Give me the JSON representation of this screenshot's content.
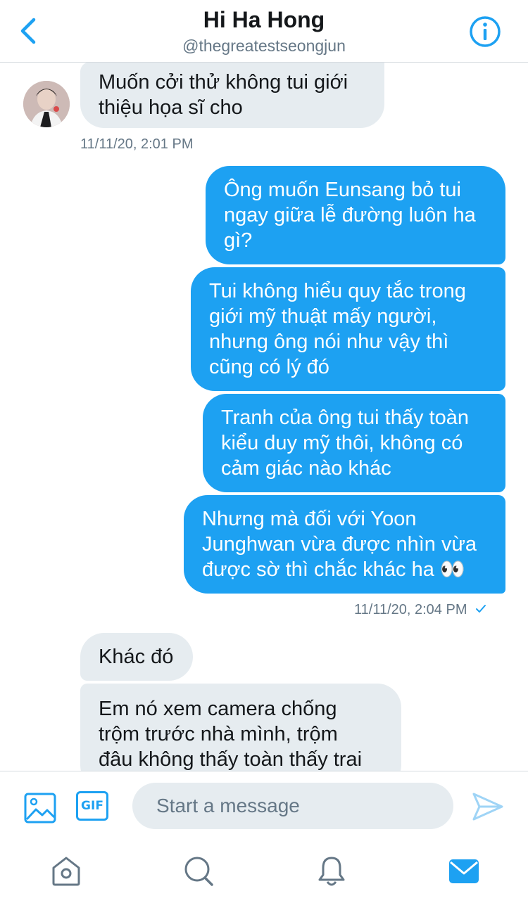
{
  "header": {
    "title": "Hi Ha Hong",
    "handle": "@thegreatestseongjun",
    "back_icon": "chevron-left-icon",
    "info_icon": "info-icon",
    "accent_color": "#1da1f2"
  },
  "messages": [
    {
      "direction": "in",
      "text": "Muốn cởi thử không tui giới\nthiệu họa sĩ cho"
    },
    {
      "direction": "out",
      "text": "Ông muốn Eunsang bỏ tui\nngay giữa lễ đường luôn ha\ngì?"
    },
    {
      "direction": "out",
      "text": "Tui không hiểu quy tắc trong\ngiới mỹ thuật mấy người,\nnhưng ông nói như vậy thì\ncũng có lý đó"
    },
    {
      "direction": "out",
      "text": "Tranh của ông tui thấy toàn\nkiểu duy mỹ thôi, không có\ncảm giác nào khác"
    },
    {
      "direction": "out",
      "text": "Nhưng mà đối với Yoon\nJunghwan vừa được nhìn vừa\nđược sờ thì chắc khác ha 👀"
    },
    {
      "direction": "in",
      "text": "Khác đó"
    },
    {
      "direction": "in",
      "text": "Em nó xem camera chống\ntrộm trước nhà mình, trộm\nđâu không thấy toàn thấy trai"
    }
  ],
  "timestamps": {
    "first": "11/11/20, 2:01 PM",
    "second": "11/11/20, 2:04 PM",
    "second_status_icon": "checkmark-icon"
  },
  "composer": {
    "placeholder": "Start a message",
    "gif_label": "GIF",
    "media_icon": "image-icon",
    "send_icon": "send-icon"
  },
  "tabbar": {
    "items": [
      "home-icon",
      "search-icon",
      "notifications-icon",
      "messages-icon"
    ],
    "active": "messages-icon"
  },
  "colors": {
    "outgoing_bubble": "#1da1f2",
    "incoming_bubble": "#e6ecf0",
    "secondary_text": "#657786"
  }
}
